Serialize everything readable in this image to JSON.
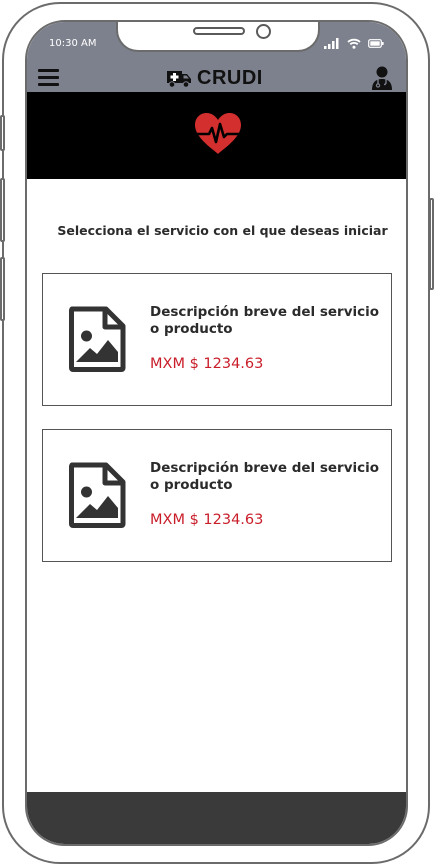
{
  "status_bar": {
    "time": "10:30 AM"
  },
  "header": {
    "title": "CRUDI",
    "brand_icon": "ambulance-icon",
    "menu_icon": "hamburger-icon",
    "profile_icon": "doctor-icon",
    "background_color": "#7d818d"
  },
  "hero": {
    "icon": "heartbeat-icon",
    "icon_color": "#d32f2f",
    "background_color": "#000000"
  },
  "main": {
    "subtitle": "Selecciona el servicio con el que deseas iniciar",
    "cards": [
      {
        "description": "Descripción breve del servicio o producto",
        "price": "MXM $ 1234.63",
        "icon": "image-file-icon"
      },
      {
        "description": "Descripción breve del servicio o producto",
        "price": "MXM $ 1234.63",
        "icon": "image-file-icon"
      }
    ],
    "price_color": "#c91e2a"
  }
}
